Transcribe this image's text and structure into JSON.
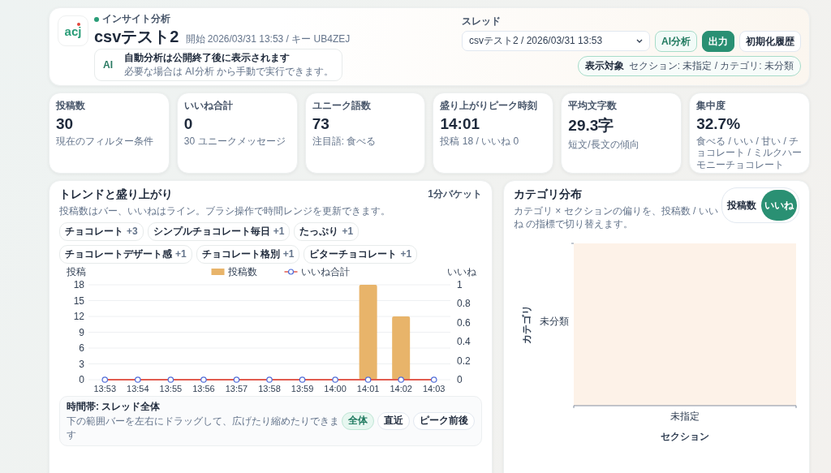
{
  "header": {
    "logo": "acj",
    "badge": "インサイト分析",
    "title": "csvテスト2",
    "meta": "開始 2026/03/31 13:53 / キー UB4ZEJ",
    "notice": {
      "icon": "AI",
      "title": "自動分析は公開終了後に表示されます",
      "text": "必要な場合は AI分析 から手動で実行できます。"
    },
    "thread": {
      "label": "スレッド",
      "value": "csvテスト2 / 2026/03/31 13:53"
    },
    "buttons": [
      {
        "label": "AI分析",
        "kind": "outline"
      },
      {
        "label": "出力",
        "kind": "primary"
      },
      {
        "label": "初期化履歴",
        "kind": "plain"
      }
    ],
    "scope": {
      "label": "表示対象",
      "value": "セクション: 未指定 / カテゴリ: 未分類"
    }
  },
  "kpis": [
    {
      "label": "投稿数",
      "value": "30",
      "note": "現在のフィルター条件"
    },
    {
      "label": "いいね合計",
      "value": "0",
      "note": "30 ユニークメッセージ"
    },
    {
      "label": "ユニーク語数",
      "value": "73",
      "note": "注目語: 食べる"
    },
    {
      "label": "盛り上がりピーク時刻",
      "value": "14:01",
      "note": "投稿 18 / いいね 0"
    },
    {
      "label": "平均文字数",
      "value": "29.3字",
      "note": "短文/長文の傾向"
    },
    {
      "label": "集中度",
      "value": "32.7%",
      "note": "食べる / いい / 甘い / チョコレート / ミルクハーモニーチョコレート"
    }
  ],
  "trend": {
    "title": "トレンドと盛り上がり",
    "subtitle": "投稿数はバー、いいねはライン。ブラシ操作で時間レンジを更新できます。",
    "bucket": "1分バケット",
    "tags": [
      {
        "label": "チョコレート",
        "count": "+3"
      },
      {
        "label": "シンプルチョコレート毎日",
        "count": "+1"
      },
      {
        "label": "たっぷり",
        "count": "+1"
      },
      {
        "label": "チョコレートデザート感",
        "count": "+1"
      },
      {
        "label": "チョコレート格別",
        "count": "+1"
      },
      {
        "label": "ビターチョコレート",
        "count": "+1"
      }
    ],
    "chart_data": {
      "type": "bar",
      "ylabel": "投稿",
      "y2label": "いいね",
      "categories": [
        "13:53",
        "13:54",
        "13:55",
        "13:56",
        "13:57",
        "13:58",
        "13:59",
        "14:00",
        "14:01",
        "14:02",
        "14:03"
      ],
      "ylim": [
        0,
        18
      ],
      "yticks": [
        0,
        3,
        6,
        9,
        12,
        15,
        18
      ],
      "y2lim": [
        0,
        1
      ],
      "y2ticks": [
        0,
        0.2,
        0.4,
        0.6,
        0.8,
        1
      ],
      "grid": true,
      "series": [
        {
          "name": "投稿数",
          "color": "#e8b46a",
          "values": [
            0,
            0,
            0,
            0,
            0,
            0,
            0,
            0,
            18,
            12,
            0
          ]
        },
        {
          "name": "いいね合計",
          "color": "#e25b4f",
          "values": [
            0,
            0,
            0,
            0,
            0,
            0,
            0,
            0,
            0,
            0,
            0
          ]
        }
      ]
    },
    "range": {
      "title": "時間帯: スレッド全体",
      "hint": "下の範囲バーを左右にドラッグして、広げたり縮めたりできます",
      "options": [
        {
          "label": "全体",
          "selected": true
        },
        {
          "label": "直近",
          "selected": false
        },
        {
          "label": "ピーク前後",
          "selected": false
        }
      ]
    }
  },
  "category": {
    "title": "カテゴリ分布",
    "subtitle": "カテゴリ × セクションの偏りを、投稿数 / いいね の指標で切り替えます。",
    "metrics": [
      {
        "label": "投稿数",
        "selected": false
      },
      {
        "label": "いいね",
        "selected": true
      }
    ],
    "heatmap": {
      "ylabel": "カテゴリ",
      "xlabel": "セクション",
      "rows": [
        "未分類"
      ],
      "columns": [
        "未指定"
      ]
    }
  }
}
